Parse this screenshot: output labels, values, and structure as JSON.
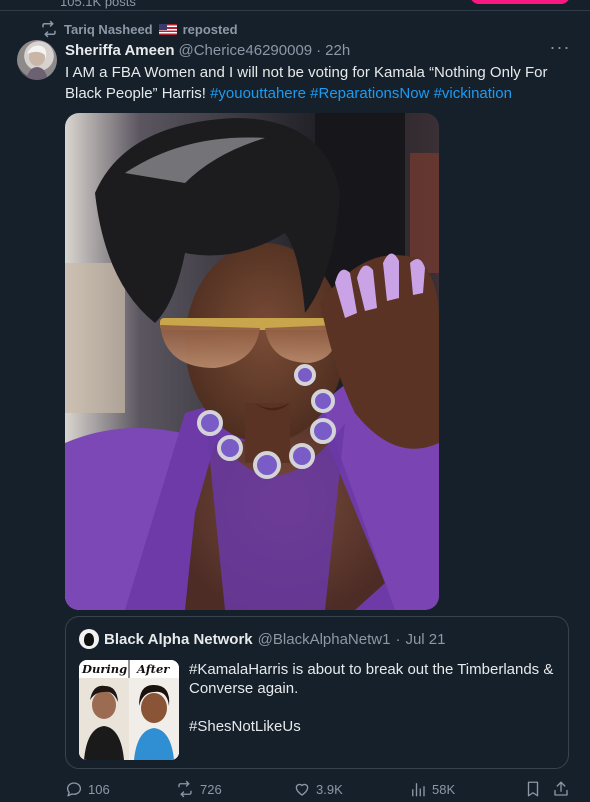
{
  "profile": {
    "posts_count": "105.1K posts"
  },
  "repost": {
    "label": "Tariq Nasheed 🇺🇸 reposted",
    "name": "Tariq Nasheed",
    "suffix": "reposted"
  },
  "post": {
    "author_name": "Sheriffa Ameen",
    "author_handle": "@Cherice46290009",
    "separator": "·",
    "time": "22h",
    "text_plain": "I AM a FBA Women and I will not be voting for Kamala “Nothing Only For Black People” Harris! ",
    "hashtags": [
      "#yououttahere",
      "#ReparationsNow",
      "#vickination"
    ]
  },
  "quote": {
    "author_name": "Black Alpha Network",
    "author_handle": "@BlackAlphaNetw1",
    "separator": "·",
    "date": "Jul 21",
    "text_line1": "#KamalaHarris is about to break out the Timberlands & Converse again.",
    "text_line2": "#ShesNotLikeUs",
    "thumb_label_left": "During",
    "thumb_label_right": "After"
  },
  "actions": {
    "replies": "106",
    "reposts": "726",
    "likes": "3.9K",
    "views": "58K"
  },
  "icons": {
    "repost": "repost-icon",
    "more": "more-icon",
    "reply": "reply-icon",
    "retweet": "retweet-icon",
    "like": "heart-icon",
    "views": "views-icon",
    "bookmark": "bookmark-icon",
    "share": "share-icon"
  },
  "colors": {
    "background": "#15202b",
    "text": "#e7e9ea",
    "muted": "#8b98a5",
    "link": "#1d9bf0",
    "border": "#38444d"
  }
}
